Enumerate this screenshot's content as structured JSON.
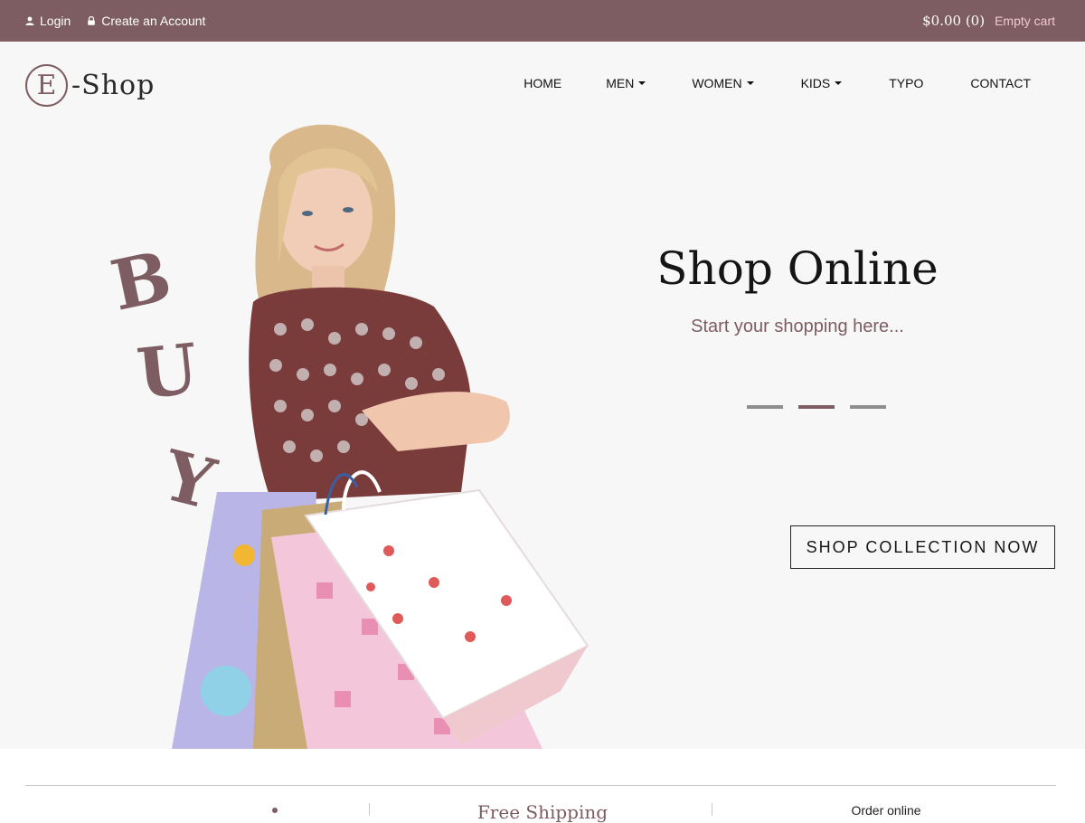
{
  "topbar": {
    "login": "Login",
    "create_account": "Create an Account",
    "cart_amount": "$0.00 (0)",
    "cart_status": "Empty cart",
    "icons": {
      "login": "user-icon",
      "account": "lock-icon"
    }
  },
  "header": {
    "logo_letter": "E",
    "logo_text": "-Shop",
    "nav": [
      {
        "label": "HOME",
        "dropdown": false
      },
      {
        "label": "MEN",
        "dropdown": true
      },
      {
        "label": "WOMEN",
        "dropdown": true
      },
      {
        "label": "KIDS",
        "dropdown": true
      },
      {
        "label": "TYPO",
        "dropdown": false
      },
      {
        "label": "CONTACT",
        "dropdown": false
      }
    ]
  },
  "hero": {
    "buy_letters": [
      "B",
      "U",
      "Y"
    ],
    "title": "Shop Online",
    "subtitle": "Start your shopping here...",
    "slides": 3,
    "active_slide": 2,
    "cta": "SHOP COLLECTION NOW"
  },
  "features": {
    "shipping_title": "Free Shipping",
    "order_title": "Order online"
  },
  "colors": {
    "brand": "#7d5d61",
    "topbar_link_accent": "#f0c9cf",
    "hero_background": "#f7f7f7"
  }
}
